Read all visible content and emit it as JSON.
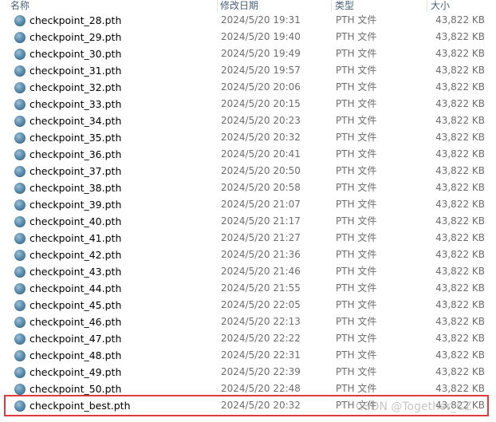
{
  "columns": {
    "name": "名称",
    "date": "修改日期",
    "type": "类型",
    "size": "大小"
  },
  "files": [
    {
      "name": "checkpoint_28.pth",
      "date": "2024/5/20 19:31",
      "type": "PTH 文件",
      "size": "43,822 KB"
    },
    {
      "name": "checkpoint_29.pth",
      "date": "2024/5/20 19:40",
      "type": "PTH 文件",
      "size": "43,822 KB"
    },
    {
      "name": "checkpoint_30.pth",
      "date": "2024/5/20 19:49",
      "type": "PTH 文件",
      "size": "43,822 KB"
    },
    {
      "name": "checkpoint_31.pth",
      "date": "2024/5/20 19:57",
      "type": "PTH 文件",
      "size": "43,822 KB"
    },
    {
      "name": "checkpoint_32.pth",
      "date": "2024/5/20 20:06",
      "type": "PTH 文件",
      "size": "43,822 KB"
    },
    {
      "name": "checkpoint_33.pth",
      "date": "2024/5/20 20:15",
      "type": "PTH 文件",
      "size": "43,822 KB"
    },
    {
      "name": "checkpoint_34.pth",
      "date": "2024/5/20 20:23",
      "type": "PTH 文件",
      "size": "43,822 KB"
    },
    {
      "name": "checkpoint_35.pth",
      "date": "2024/5/20 20:32",
      "type": "PTH 文件",
      "size": "43,822 KB"
    },
    {
      "name": "checkpoint_36.pth",
      "date": "2024/5/20 20:41",
      "type": "PTH 文件",
      "size": "43,822 KB"
    },
    {
      "name": "checkpoint_37.pth",
      "date": "2024/5/20 20:50",
      "type": "PTH 文件",
      "size": "43,822 KB"
    },
    {
      "name": "checkpoint_38.pth",
      "date": "2024/5/20 20:58",
      "type": "PTH 文件",
      "size": "43,822 KB"
    },
    {
      "name": "checkpoint_39.pth",
      "date": "2024/5/20 21:07",
      "type": "PTH 文件",
      "size": "43,822 KB"
    },
    {
      "name": "checkpoint_40.pth",
      "date": "2024/5/20 21:17",
      "type": "PTH 文件",
      "size": "43,822 KB"
    },
    {
      "name": "checkpoint_41.pth",
      "date": "2024/5/20 21:27",
      "type": "PTH 文件",
      "size": "43,822 KB"
    },
    {
      "name": "checkpoint_42.pth",
      "date": "2024/5/20 21:36",
      "type": "PTH 文件",
      "size": "43,822 KB"
    },
    {
      "name": "checkpoint_43.pth",
      "date": "2024/5/20 21:46",
      "type": "PTH 文件",
      "size": "43,822 KB"
    },
    {
      "name": "checkpoint_44.pth",
      "date": "2024/5/20 21:55",
      "type": "PTH 文件",
      "size": "43,822 KB"
    },
    {
      "name": "checkpoint_45.pth",
      "date": "2024/5/20 22:05",
      "type": "PTH 文件",
      "size": "43,822 KB"
    },
    {
      "name": "checkpoint_46.pth",
      "date": "2024/5/20 22:13",
      "type": "PTH 文件",
      "size": "43,822 KB"
    },
    {
      "name": "checkpoint_47.pth",
      "date": "2024/5/20 22:22",
      "type": "PTH 文件",
      "size": "43,822 KB"
    },
    {
      "name": "checkpoint_48.pth",
      "date": "2024/5/20 22:31",
      "type": "PTH 文件",
      "size": "43,822 KB"
    },
    {
      "name": "checkpoint_49.pth",
      "date": "2024/5/20 22:39",
      "type": "PTH 文件",
      "size": "43,822 KB"
    },
    {
      "name": "checkpoint_50.pth",
      "date": "2024/5/20 22:48",
      "type": "PTH 文件",
      "size": "43,822 KB"
    }
  ],
  "best_file": {
    "name": "checkpoint_best.pth",
    "date": "2024/5/20 20:32",
    "type": "PTH 文件",
    "size": "43,822 KB"
  },
  "file_icon": "pth-file-icon",
  "highlight_color": "#e0393e",
  "watermark": "CSDN @Together_CZ"
}
